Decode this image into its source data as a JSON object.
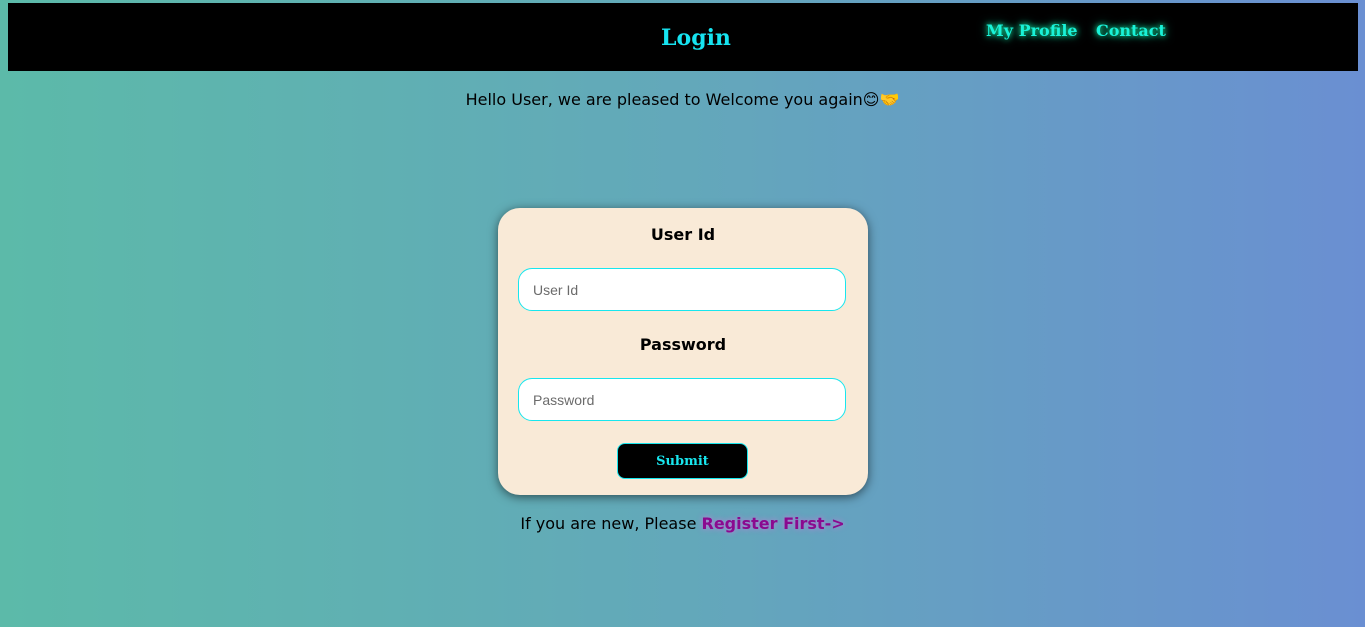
{
  "header": {
    "title": "Login",
    "nav": {
      "profile": "My Profile",
      "contact": "Contact"
    }
  },
  "welcome": {
    "text": "Hello User, we are pleased to Welcome you again😊🤝"
  },
  "form": {
    "userid_label": "User Id",
    "userid_placeholder": "User Id",
    "userid_value": "",
    "password_label": "Password",
    "password_placeholder": "Password",
    "password_value": "",
    "submit_label": "Submit"
  },
  "register": {
    "prompt": "If you are new, Please ",
    "link_label": "Register First->"
  },
  "colors": {
    "accent_cyan": "#18e6ee",
    "nav_green": "#19f2d8",
    "card_bg": "#f9ead7",
    "link_purple": "#8a0a8f"
  }
}
